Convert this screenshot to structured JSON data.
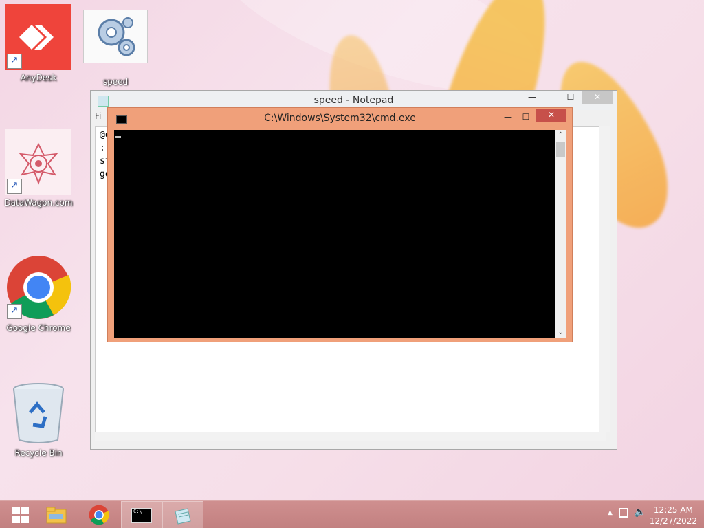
{
  "desktop": {
    "icons": [
      {
        "label": "AnyDesk",
        "icon": "anydesk-icon"
      },
      {
        "label": "speed",
        "icon": "gear-icon"
      },
      {
        "label": "DataWagon.com",
        "icon": "datawagon-icon"
      },
      {
        "label": "Google Chrome",
        "icon": "chrome-icon"
      },
      {
        "label": "Recycle Bin",
        "icon": "recycle-bin-icon"
      }
    ]
  },
  "notepad": {
    "title": "speed - Notepad",
    "menu_first": "Fi",
    "lines": [
      "@e",
      "::",
      "st",
      "go"
    ],
    "controls": {
      "minimize": "—",
      "maximize": "☐",
      "close": "✕"
    }
  },
  "cmd": {
    "title": "C:\\Windows\\System32\\cmd.exe",
    "controls": {
      "minimize": "—",
      "maximize": "☐",
      "close": "✕"
    }
  },
  "taskbar": {
    "items": [
      "start-button",
      "file-explorer",
      "chrome",
      "cmd",
      "notepad"
    ],
    "time": "12:25 AM",
    "date": "12/27/2022"
  },
  "colors": {
    "cmd_frame": "#f0a07a",
    "close_red": "#c7504a",
    "taskbar": "#c98888"
  }
}
